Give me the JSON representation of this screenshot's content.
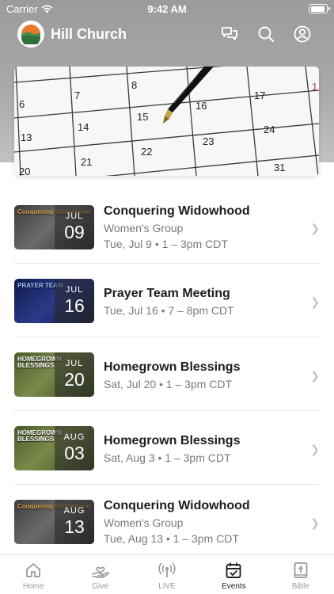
{
  "status_bar": {
    "carrier": "Carrier",
    "time": "9:42 AM",
    "battery_level": 0.95
  },
  "app_bar": {
    "title": "Hill Church"
  },
  "hero": {
    "calendar_numbers": [
      "6",
      "7",
      "8",
      "13",
      "14",
      "15",
      "16",
      "17",
      "20",
      "21",
      "22",
      "23",
      "24",
      "31",
      "1"
    ]
  },
  "events": [
    {
      "title": "Conquering Widowhood",
      "subtitle": "Women's Group",
      "time": "Tue, Jul 9 • 1 – 3pm CDT",
      "month": "JUL",
      "day": "09",
      "thumb_label": "Conquering Widowhood"
    },
    {
      "title": "Prayer Team Meeting",
      "subtitle": "",
      "time": "Tue, Jul 16 • 7 – 8pm CDT",
      "month": "JUL",
      "day": "16",
      "thumb_label": "PRAYER TEAM"
    },
    {
      "title": "Homegrown Blessings",
      "subtitle": "",
      "time": "Sat, Jul 20 • 1 – 3pm CDT",
      "month": "JUL",
      "day": "20",
      "thumb_label": "HOMEGROWN BLESSINGS"
    },
    {
      "title": "Homegrown Blessings",
      "subtitle": "",
      "time": "Sat, Aug 3 • 1 – 3pm CDT",
      "month": "AUG",
      "day": "03",
      "thumb_label": "HOMEGROWN BLESSINGS"
    },
    {
      "title": "Conquering Widowhood",
      "subtitle": "Women's Group",
      "time": "Tue, Aug 13 • 1 – 3pm CDT",
      "month": "AUG",
      "day": "13",
      "thumb_label": "Conquering Widowhood"
    }
  ],
  "tabs": [
    {
      "label": "Home",
      "icon": "home-icon",
      "active": false
    },
    {
      "label": "Give",
      "icon": "give-icon",
      "active": false
    },
    {
      "label": "LIVE",
      "icon": "live-icon",
      "active": false
    },
    {
      "label": "Events",
      "icon": "calendar-icon",
      "active": true
    },
    {
      "label": "Bible",
      "icon": "bible-icon",
      "active": false
    }
  ],
  "colors": {
    "header_gray": "#a9a9a9",
    "accent_text": "#1d1d1d",
    "muted_text": "#7a7a7a",
    "pen_gold": "#c9a24a"
  }
}
